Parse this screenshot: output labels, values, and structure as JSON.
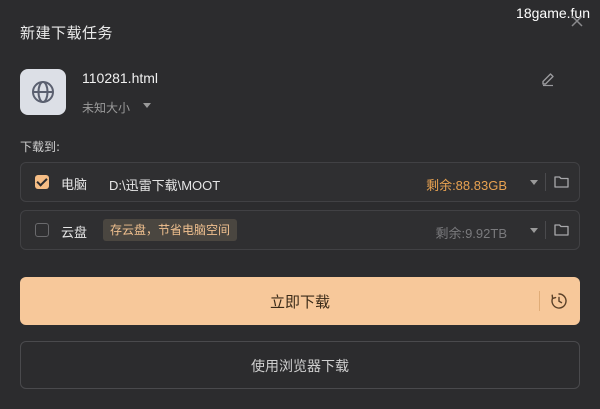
{
  "dialog": {
    "title": "新建下载任务",
    "watermark": "18game.fun"
  },
  "file": {
    "name": "110281.html",
    "size": "未知大小",
    "icon": "globe-icon"
  },
  "save_to": {
    "label": "下载到:",
    "pc": {
      "checked": true,
      "label": "电脑",
      "path": "D:\\迅雷下载\\MOOT",
      "free_space": "剩余:88.83GB"
    },
    "cloud": {
      "checked": false,
      "label": "云盘",
      "tip": "存云盘，节省电脑空间",
      "free_space": "剩余:9.92TB"
    }
  },
  "actions": {
    "download_now": "立即下载",
    "browser_download": "使用浏览器下载"
  },
  "colors": {
    "accent": "#f7c89a",
    "free_space_pc": "#e8a251",
    "background": "#2c2c2e"
  }
}
